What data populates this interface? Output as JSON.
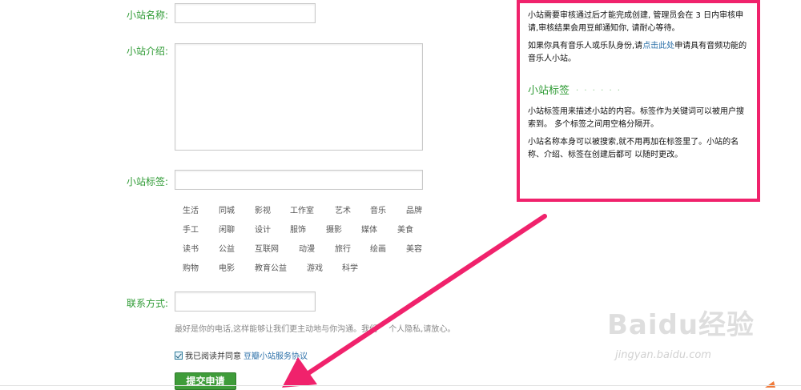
{
  "form": {
    "name_label": "小站名称:",
    "intro_label": "小站介绍:",
    "tags_label": "小站标签:",
    "contact_label": "联系方式:",
    "name_value": "",
    "intro_value": "",
    "tags_value": "",
    "contact_value": "",
    "tag_rows": [
      [
        "生活",
        "同城",
        "影视",
        "工作室",
        "艺术",
        "音乐",
        "品牌"
      ],
      [
        "手工",
        "闲聊",
        "设计",
        "服饰",
        "摄影",
        "媒体",
        "美食"
      ],
      [
        "读书",
        "公益",
        "互联网",
        "动漫",
        "旅行",
        "绘画",
        "美容"
      ],
      [
        "购物",
        "电影",
        "教育公益",
        "游戏",
        "科学"
      ]
    ],
    "contact_hint": "最好是你的电话,这样能够让我们更主动地与你沟通。我们",
    "contact_hint_tail": "个人隐私,请放心。",
    "agree_text": "我已阅读并同意",
    "agree_link": "豆瓣小站服务协议",
    "submit_label": "提交申请"
  },
  "sidebar": {
    "p1": "小站需要审核通过后才能完成创建, 管理员会在 3 日内审核申请,审核结果会用豆邮通知你, 请耐心等待。",
    "p2_before": "如果你具有音乐人或乐队身份,请",
    "p2_link": "点击此处",
    "p2_after": "申请具有音频功能的音乐人小站。",
    "tags_title": "小站标签",
    "tags_dots": "· · · · · ·",
    "p3": "小站标签用来描述小站的内容。标签作为关键词可以被用户搜索到。 多个标签之间用空格分隔开。",
    "p4": "小站名称本身可以被搜索,就不用再加在标签里了。小站的名称、介绍、标签在创建后都可 以随时更改。"
  },
  "watermark": {
    "brand": "Baidu经验",
    "url": "jingyan.baidu.com"
  },
  "colors": {
    "label_green": "#2f9b35",
    "highlight_pink": "#f0226c",
    "button_green": "#3f9c3a",
    "link_blue": "#2a6fa8"
  }
}
